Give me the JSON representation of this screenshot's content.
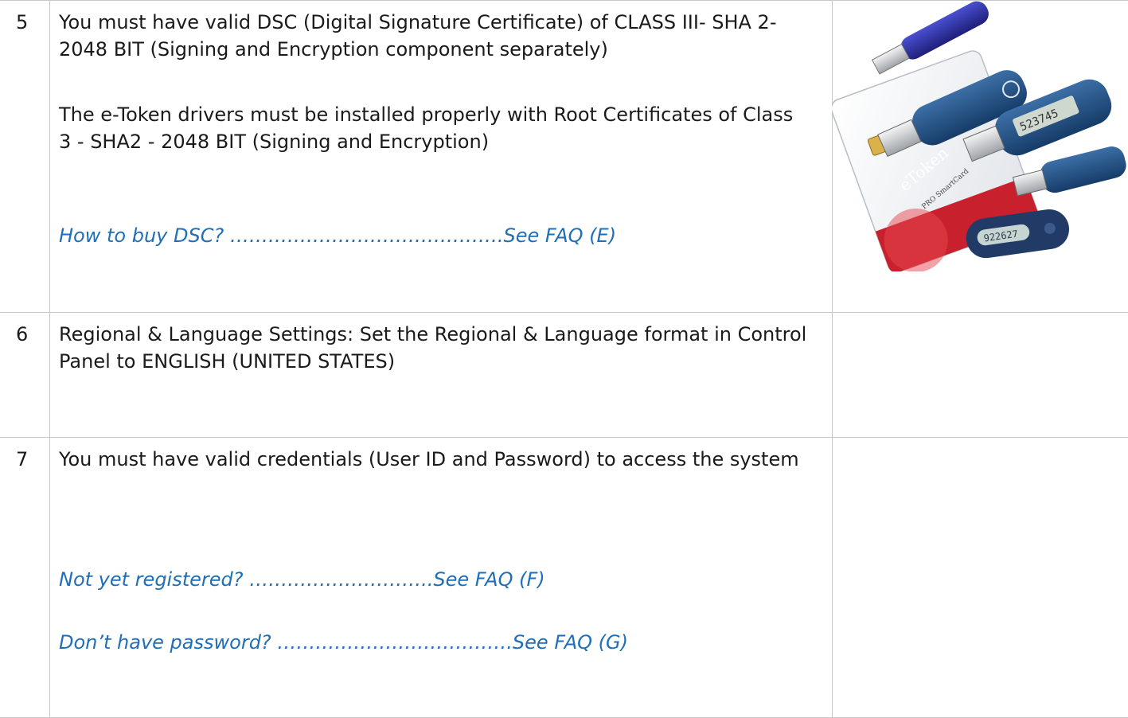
{
  "rows": [
    {
      "number": "5",
      "lines": [
        "You must have valid DSC (Digital Signature Certificate) of CLASS III- SHA 2-2048 BIT (Signing and Encryption component separately)",
        "The e-Token drivers must be installed properly with Root Certificates of Class 3 - SHA2 - 2048 BIT (Signing and Encryption)"
      ],
      "link": "How to buy DSC? …………………………………….See FAQ (E)",
      "image": {
        "card_brand": "eToken",
        "card_sub": "PRO SmartCard",
        "token_display_1": "523745",
        "token_display_2": "922627"
      }
    },
    {
      "number": "6",
      "lines": [
        "Regional & Language Settings: Set the Regional & Language format in Control Panel to ENGLISH (UNITED STATES)"
      ]
    },
    {
      "number": "7",
      "lines": [
        "You must have valid credentials (User ID and Password) to access the system"
      ],
      "links": [
        "Not yet registered? ………………………..See FAQ (F)",
        "Don’t have password? ……………………………….See FAQ (G)"
      ]
    }
  ]
}
